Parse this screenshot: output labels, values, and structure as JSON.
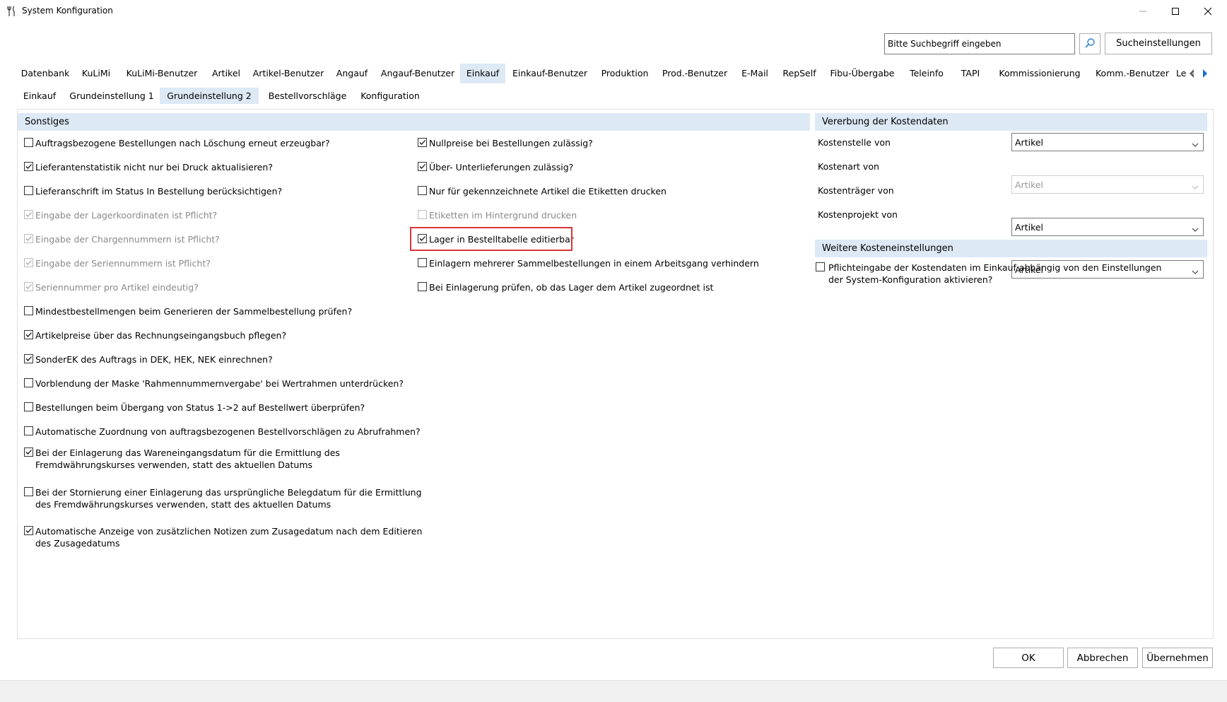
{
  "window": {
    "title": "System Konfiguration",
    "minimize_icon": "minimize-icon",
    "maximize_icon": "maximize-icon",
    "close_icon": "close-icon"
  },
  "search": {
    "placeholder": "Bitte Suchbegriff eingeben",
    "value": "",
    "button_icon": "search-icon",
    "settings_label": "Sucheinstellungen"
  },
  "main_tabs": [
    {
      "label": "Datenbank"
    },
    {
      "label": "KuLiMi"
    },
    {
      "label": "KuLiMi-Benutzer"
    },
    {
      "label": "Artikel"
    },
    {
      "label": "Artikel-Benutzer"
    },
    {
      "label": "Angauf"
    },
    {
      "label": "Angauf-Benutzer"
    },
    {
      "label": "Einkauf",
      "active": true
    },
    {
      "label": "Einkauf-Benutzer"
    },
    {
      "label": "Produktion"
    },
    {
      "label": "Prod.-Benutzer"
    },
    {
      "label": "E-Mail"
    },
    {
      "label": "RepSelf"
    },
    {
      "label": "Fibu-Übergabe"
    },
    {
      "label": "Teleinfo"
    },
    {
      "label": "TAPI"
    },
    {
      "label": "Kommissionierung"
    },
    {
      "label": "Komm.-Benutzer"
    },
    {
      "label": "Le"
    }
  ],
  "tab_scroll": {
    "left_icon": "scroll-left-icon",
    "right_icon": "scroll-right-icon"
  },
  "sub_tabs": [
    {
      "label": "Einkauf"
    },
    {
      "label": "Grundeinstellung 1"
    },
    {
      "label": "Grundeinstellung 2",
      "active": true
    },
    {
      "label": "Bestellvorschläge"
    },
    {
      "label": "Konfiguration"
    }
  ],
  "sonstiges": {
    "header": "Sonstiges",
    "left": [
      {
        "label": "Auftragsbezogene Bestellungen nach Löschung erneut erzeugbar?",
        "checked": false,
        "disabled": false
      },
      {
        "label": "Lieferantenstatistik nicht nur bei Druck aktualisieren?",
        "checked": true,
        "disabled": false
      },
      {
        "label": "Lieferanschrift im Status In Bestellung berücksichtigen?",
        "checked": false,
        "disabled": false
      },
      {
        "label": "Eingabe der Lagerkoordinaten ist Pflicht?",
        "checked": true,
        "disabled": true
      },
      {
        "label": "Eingabe der Chargennummern ist Pflicht?",
        "checked": true,
        "disabled": true
      },
      {
        "label": "Eingabe der Seriennummern ist Pflicht?",
        "checked": true,
        "disabled": true
      },
      {
        "label": "Seriennummer pro Artikel eindeutig?",
        "checked": true,
        "disabled": true
      },
      {
        "label": "Mindestbestellmengen beim Generieren der Sammelbestellung prüfen?",
        "checked": false,
        "disabled": false
      },
      {
        "label": "Artikelpreise über das Rechnungseingangsbuch pflegen?",
        "checked": true,
        "disabled": false
      },
      {
        "label": "SonderEK des Auftrags in DEK, HEK, NEK einrechnen?",
        "checked": true,
        "disabled": false
      },
      {
        "label": "Vorblendung der Maske 'Rahmennummernvergabe' bei Wertrahmen unterdrücken?",
        "checked": false,
        "disabled": false
      },
      {
        "label": "Bestellungen beim Übergang von Status 1->2 auf Bestellwert überprüfen?",
        "checked": false,
        "disabled": false
      },
      {
        "label": "Automatische Zuordnung von auftragsbezogenen Bestellvorschlägen zu Abrufrahmen?",
        "checked": false,
        "disabled": false
      },
      {
        "label": "Bei der Einlagerung das Wareneingangsdatum für die Ermittlung des Fremdwährungskurses verwenden, statt des aktuellen Datums",
        "checked": true,
        "disabled": false
      },
      {
        "label": "Bei der Stornierung einer Einlagerung das ursprüngliche Belegdatum für die Ermittlung des Fremdwährungskurses verwenden, statt des aktuellen Datums",
        "checked": false,
        "disabled": false
      },
      {
        "label": "Automatische Anzeige von zusätzlichen Notizen zum Zusagedatum nach dem Editieren des Zusagedatums",
        "checked": true,
        "disabled": false
      }
    ],
    "middle": [
      {
        "label": "Nullpreise bei Bestellungen zulässig?",
        "checked": true,
        "disabled": false
      },
      {
        "label": "Über- Unterlieferungen zulässig?",
        "checked": true,
        "disabled": false
      },
      {
        "label": "Nur für gekennzeichnete Artikel die Etiketten drucken",
        "checked": false,
        "disabled": false
      },
      {
        "label": "Etiketten im Hintergrund drucken",
        "checked": false,
        "disabled": true
      },
      {
        "label": "Lager in Bestelltabelle editierbar",
        "checked": true,
        "disabled": false,
        "highlighted": true
      },
      {
        "label": "Einlagern mehrerer Sammelbestellungen in einem Arbeitsgang verhindern",
        "checked": false,
        "disabled": false
      },
      {
        "label": "Bei Einlagerung prüfen, ob das Lager dem Artikel zugeordnet ist",
        "checked": false,
        "disabled": false
      }
    ]
  },
  "vererbung": {
    "header": "Vererbung der Kostendaten",
    "rows": [
      {
        "label": "Kostenstelle von",
        "value": "Artikel",
        "disabled": false
      },
      {
        "label": "Kostenart von",
        "value": "Artikel",
        "disabled": true
      },
      {
        "label": "Kostenträger von",
        "value": "Artikel",
        "disabled": false
      },
      {
        "label": "Kostenprojekt von",
        "value": "Artikel",
        "disabled": false
      }
    ]
  },
  "weitere": {
    "header": "Weitere Kosteneinstellungen",
    "checkbox": {
      "label": "Pflichteingabe der Kostendaten im Einkauf abhängig von den Einstellungen der System-Konfiguration aktivieren?",
      "checked": false
    }
  },
  "buttons": {
    "ok": "OK",
    "cancel": "Abbrechen",
    "apply": "Übernehmen"
  },
  "colors": {
    "accent": "#dde9f5",
    "highlight": "#d9383a",
    "search_icon": "#2a7fd4"
  }
}
